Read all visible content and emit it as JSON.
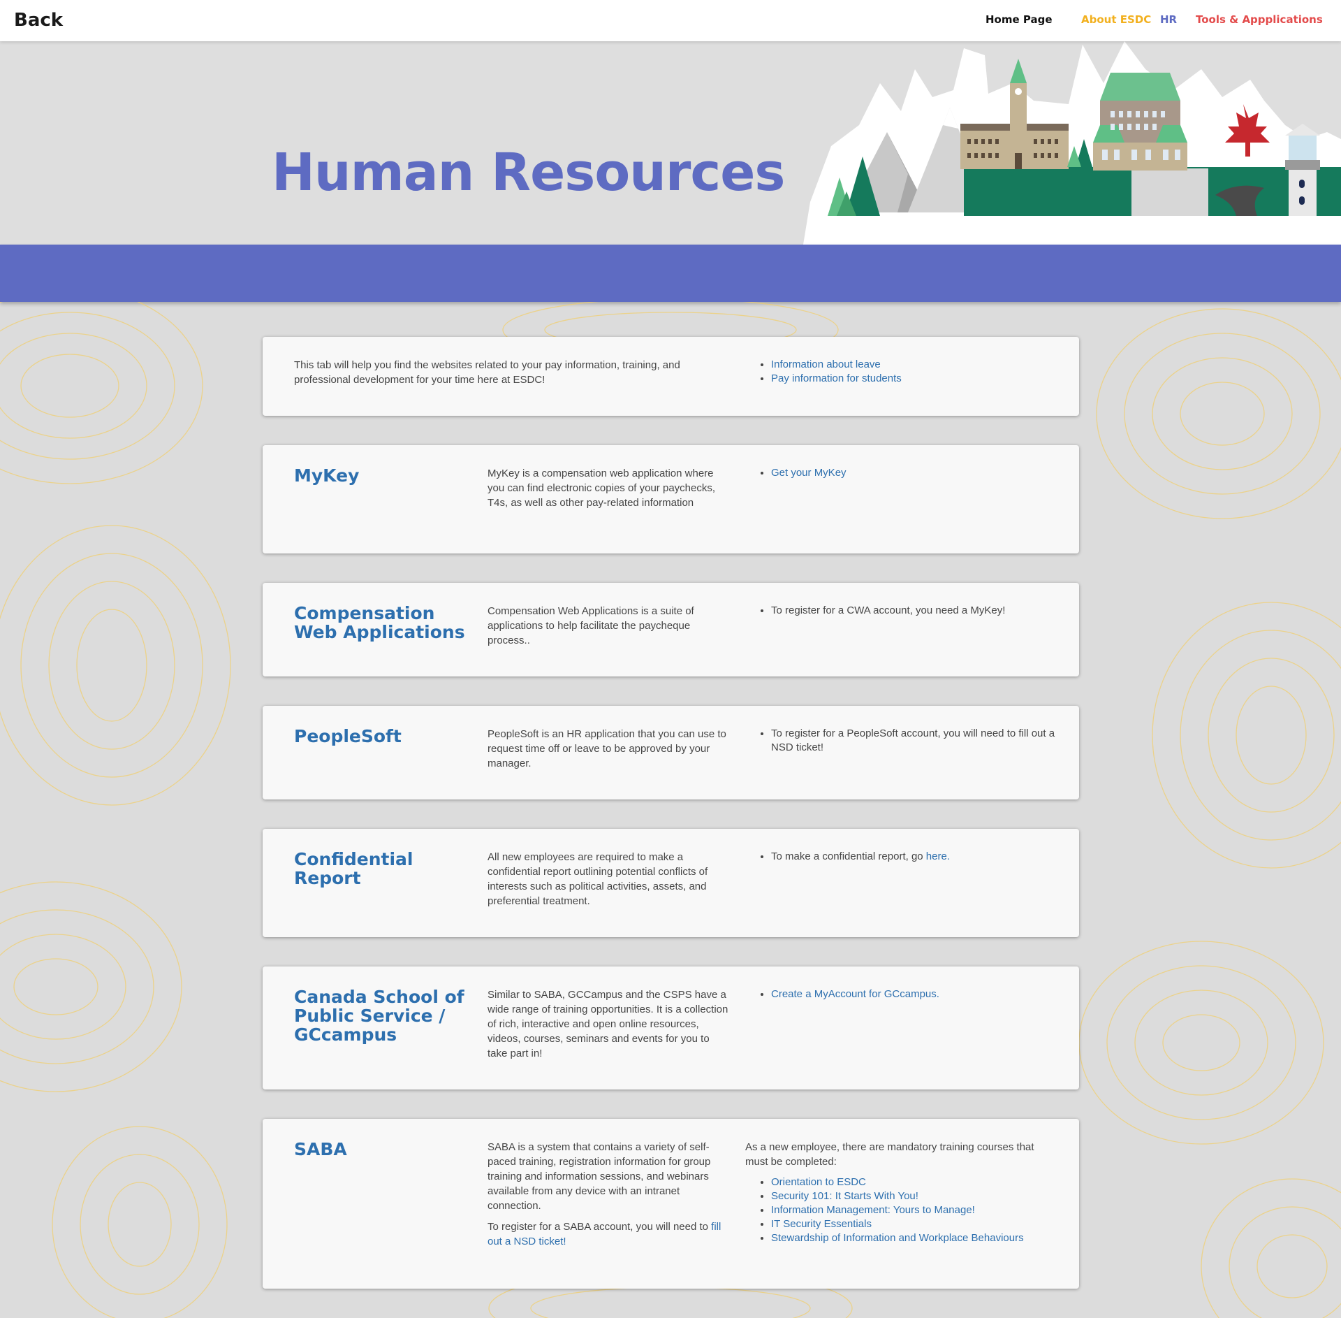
{
  "topbar": {
    "back_label": "Back",
    "nav": [
      {
        "label": "Home Page",
        "color": "#111111"
      },
      {
        "label": "About ESDC",
        "color": "#f2b01e"
      },
      {
        "label": "HR",
        "color": "#5e6bc2"
      },
      {
        "label": "Tools & Appplications",
        "color": "#e34b4b"
      }
    ]
  },
  "hero": {
    "title": "Human Resources"
  },
  "colors": {
    "accent": "#5e6bc2",
    "link": "#2d6fae",
    "topo_line": "#f1cf6f"
  },
  "intro": {
    "text": "This tab will help you find the websites related to your pay information, training, and professional development for your time here at ESDC!",
    "links": [
      "Information about leave",
      "Pay information for students"
    ]
  },
  "cards": [
    {
      "title": "MyKey",
      "desc": "MyKey is a compensation web application where you can find electronic copies of your paychecks, T4s, as well as other pay-related information",
      "link": "Get your MyKey"
    },
    {
      "title": "Compensation Web Applications",
      "desc": "Compensation Web Applications is a suite of applications to help facilitate the paycheque process..",
      "item": "To register for a CWA account, you need a MyKey!"
    },
    {
      "title": "PeopleSoft",
      "desc": "PeopleSoft is an HR application that you can use to request time off or leave to be approved by your manager.",
      "item": "To register for a PeopleSoft account, you will need to fill out a NSD ticket!"
    },
    {
      "title": "Confidential Report",
      "desc": "All new employees are required to make a confidential report outlining potential conflicts of interests such as political activities, assets, and preferential treatment.",
      "item_prefix": "To make a confidential report, go ",
      "item_link": "here."
    },
    {
      "title": "Canada School of Public Service / GCcampus",
      "desc": "Similar to SABA, GCCampus and the CSPS have a wide range of training opportunities. It is a collection of rich, interactive and open online resources, videos, courses, seminars and events for you to take part in!",
      "link": "Create a MyAccount for GCcampus."
    },
    {
      "title": "SABA",
      "desc": "SABA is a system that contains a variety of self-paced training, registration information for group training and information sessions, and webinars available from any device with an intranet connection.",
      "desc2_prefix": "To register for a SABA account, you will need to ",
      "desc2_link": "fill out a NSD ticket!",
      "list_intro": "As a new employee, there are mandatory training courses that must be completed:",
      "courses": [
        "Orientation to ESDC",
        "Security 101: It Starts With You!",
        "Information Management: Yours to Manage!",
        "IT Security Essentials",
        "Stewardship of Information and Workplace Behaviours"
      ]
    }
  ]
}
